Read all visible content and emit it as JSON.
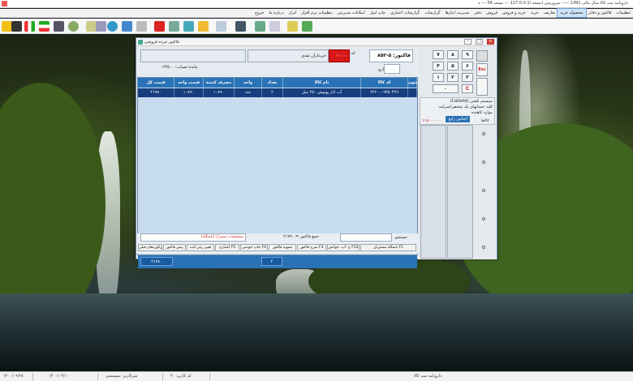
{
  "titlebar": {
    "text": "دارونامه ثبت کالا  سال مالی 1391 ----- سرورمین (نسخه ا127.0.0.1 --- نسخه 58 --- ه"
  },
  "menu": {
    "items": [
      "تنظیمات",
      "فاکتور و دفاتر",
      "محصوله خرید",
      "تعاریف",
      "خرید",
      "خرید و فروش",
      "فروش",
      "دفتر",
      "مدیریت انبارها",
      "گزارشات",
      "گزارشات اعتباری",
      "چاپ لیبل",
      "امکانات مدیریتی",
      "تنظیمات نرم افزار",
      "ابزار",
      "درباره ما",
      "خروج"
    ],
    "active_index": 2
  },
  "window": {
    "title": "فاکتور خرده فروشی",
    "code_label": "کد:",
    "code_value": "۱۰۰۰۰",
    "customer_value": "خریداران نقدی",
    "invoice_label": "فاکتور:",
    "invoice_value": "۵-۸۵۳",
    "balance_label": "مانده حساب: ۲۴۵۰۰-",
    "weight_label": "وزن ترازو:",
    "col_label": "ستون",
    "columns": [
      "کد کالا",
      "نام کالا",
      "تعداد",
      "واحد",
      "مصرف کننده",
      "قیمت واحد",
      "قیمت کل"
    ],
    "row": {
      "code": "۶۲۶۰۰۰۹۴۵۰۴۶۹",
      "name": "آب انار پهنوش ۲۵۰ میل",
      "qty": "۲",
      "unit": "عدد",
      "consumer": "۱۰۸۹۰",
      "unit_price": "۱۰۸۹۰",
      "total": "۲۱۷۸۰"
    },
    "total_qty": "۲",
    "total_price": "۲۱۷۸۰",
    "foot_sum_label": "جمع فاکتور = ۲۱۷۹۰",
    "foot_note": "مشخصات مشترک [باشگاه]",
    "search_label": "جستجو",
    "foot_buttons": [
      "باشگاه مشتریان F1",
      "ج. آپ. خوانش F12",
      "شرح فاکتور F3",
      "تسویه فاکتور",
      "چاپ خودمی F4",
      "اعتباری F5",
      "تغییر رمز ثابت",
      "پیش فاکتور",
      "رکوردهای قبلی"
    ]
  },
  "keypad": {
    "keys": [
      "۹",
      "۸",
      "۷",
      "۶",
      "۵",
      "۴",
      "۳",
      "۲",
      "۱",
      "Esc",
      "۰",
      "."
    ],
    "esc_label": "Esc"
  },
  "right_panel": {
    "options": [
      "سیستم تلفنی (CallerId)",
      "کلیه حسابهای یک شخص/شرکت",
      "موارد کاهنده",
      "اجناس رایج"
    ],
    "sub_value": "۲۱۵۰۰۰۰۰۰۰",
    "col_header": "کالاها"
  },
  "status": {
    "left": "۱۴۰۰/۰۹/۲۸",
    "mid1": "۱۴۰۰/۰۲/۱۰",
    "mid2": "شرکاربر: سیستمی",
    "mid3": "کد کاربر: ۴۰",
    "right": "دارونامه ثبت کالا"
  }
}
